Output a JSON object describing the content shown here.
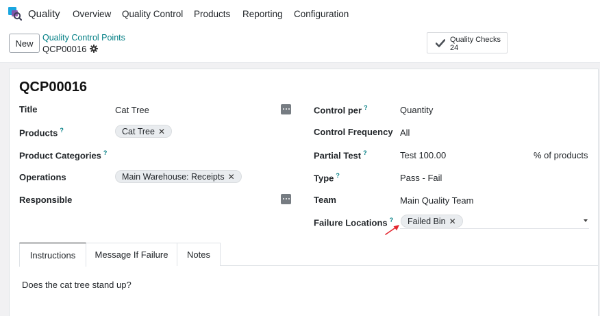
{
  "topbar": {
    "app_name": "Quality",
    "menu": [
      "Overview",
      "Quality Control",
      "Products",
      "Reporting",
      "Configuration"
    ]
  },
  "control": {
    "new_label": "New",
    "breadcrumb_parent": "Quality Control Points",
    "breadcrumb_current": "QCP00016",
    "quality_checks_label": "Quality Checks",
    "quality_checks_count": "24"
  },
  "record": {
    "title": "QCP00016",
    "left": {
      "title_label": "Title",
      "title_value": "Cat Tree",
      "products_label": "Products",
      "products_tag": "Cat Tree",
      "product_categories_label": "Product Categories",
      "operations_label": "Operations",
      "operations_tag": "Main Warehouse: Receipts",
      "responsible_label": "Responsible"
    },
    "right": {
      "control_per_label": "Control per",
      "control_per_value": "Quantity",
      "control_frequency_label": "Control Frequency",
      "control_frequency_value": "All",
      "partial_test_label": "Partial Test",
      "partial_test_value": "Test 100.00",
      "partial_test_unit": "% of products",
      "type_label": "Type",
      "type_value": "Pass - Fail",
      "team_label": "Team",
      "team_value": "Main Quality Team",
      "failure_locations_label": "Failure Locations",
      "failure_locations_tag": "Failed Bin"
    },
    "help_mark": "?",
    "tag_remove": "✕"
  },
  "tabs": {
    "items": [
      "Instructions",
      "Message If Failure",
      "Notes"
    ],
    "active_index": 0,
    "instructions_text": "Does the cat tree stand up?"
  },
  "colors": {
    "accent": "#017e84",
    "annotation_arrow": "#e3262f"
  }
}
